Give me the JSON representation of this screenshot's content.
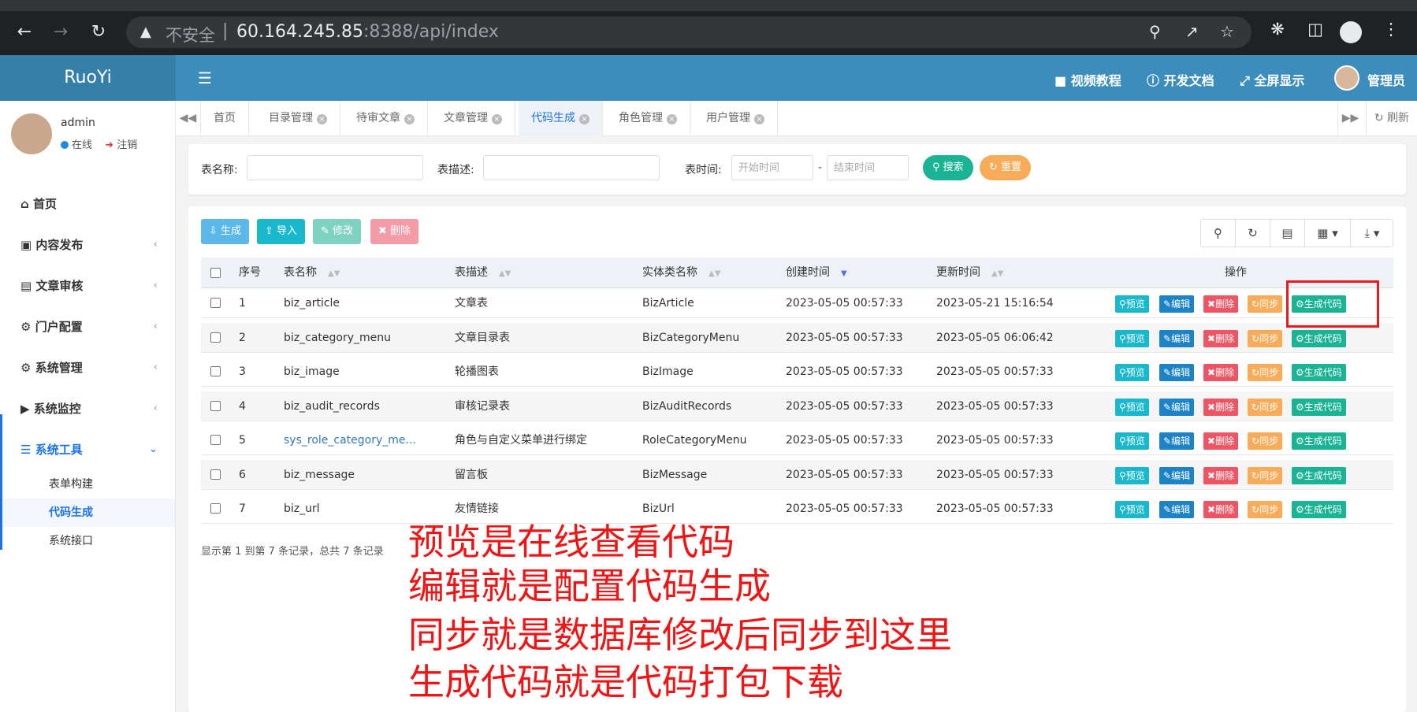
{
  "browser": {
    "insecure_label": "不安全",
    "url_host": "60.164.245.85",
    "url_rest": ":8388/api/index"
  },
  "app": {
    "logo": "RuoYi",
    "top_links": {
      "video": "视频教程",
      "docs": "开发文档",
      "fullscreen": "全屏显示",
      "user": "管理员"
    }
  },
  "sidebar": {
    "username": "admin",
    "online": "在线",
    "logout": "注销",
    "items": [
      {
        "label": "首页"
      },
      {
        "label": "内容发布"
      },
      {
        "label": "文章审核"
      },
      {
        "label": "门户配置"
      },
      {
        "label": "系统管理"
      },
      {
        "label": "系统监控"
      },
      {
        "label": "系统工具"
      }
    ],
    "subitems": [
      {
        "label": "表单构建"
      },
      {
        "label": "代码生成"
      },
      {
        "label": "系统接口"
      }
    ]
  },
  "tabs": {
    "items": [
      "首页",
      "目录管理",
      "待审文章",
      "文章管理",
      "代码生成",
      "角色管理",
      "用户管理"
    ],
    "refresh": "刷新"
  },
  "search": {
    "table_name_label": "表名称:",
    "table_desc_label": "表描述:",
    "table_time_label": "表时间:",
    "start_placeholder": "开始时间",
    "end_placeholder": "结束时间",
    "dash": "-",
    "search_btn": "搜索",
    "reset_btn": "重置"
  },
  "toolbar": {
    "generate": "生成",
    "import": "导入",
    "edit": "修改",
    "delete": "删除"
  },
  "table": {
    "headers": [
      "序号",
      "表名称",
      "表描述",
      "实体类名称",
      "创建时间",
      "更新时间",
      "操作"
    ],
    "actions": {
      "preview": "预览",
      "edit": "编辑",
      "delete": "删除",
      "sync": "同步",
      "gen": "生成代码"
    },
    "rows": [
      [
        "1",
        "biz_article",
        "文章表",
        "BizArticle",
        "2023-05-05 00:57:33",
        "2023-05-21 15:16:54"
      ],
      [
        "2",
        "biz_category_menu",
        "文章目录表",
        "BizCategoryMenu",
        "2023-05-05 00:57:33",
        "2023-05-05 06:06:42"
      ],
      [
        "3",
        "biz_image",
        "轮播图表",
        "BizImage",
        "2023-05-05 00:57:33",
        "2023-05-05 00:57:33"
      ],
      [
        "4",
        "biz_audit_records",
        "审核记录表",
        "BizAuditRecords",
        "2023-05-05 00:57:33",
        "2023-05-05 00:57:33"
      ],
      [
        "5",
        "sys_role_category_me...",
        "角色与自定义菜单进行绑定",
        "RoleCategoryMenu",
        "2023-05-05 00:57:33",
        "2023-05-05 00:57:33"
      ],
      [
        "6",
        "biz_message",
        "留言板",
        "BizMessage",
        "2023-05-05 00:57:33",
        "2023-05-05 00:57:33"
      ],
      [
        "7",
        "biz_url",
        "友情链接",
        "BizUrl",
        "2023-05-05 00:57:33",
        "2023-05-05 00:57:33"
      ]
    ],
    "footer": "显示第 1 到第 7 条记录，总共 7 条记录"
  },
  "annotations": [
    "预览是在线查看代码",
    "编辑就是配置代码生成",
    "同步就是数据库修改后同步到这里",
    "生成代码就是代码打包下载"
  ],
  "colors": {
    "header": "#3c8dbc",
    "logo": "#367fa9",
    "annotation": "#f01414",
    "highlight": "#e8191f"
  }
}
